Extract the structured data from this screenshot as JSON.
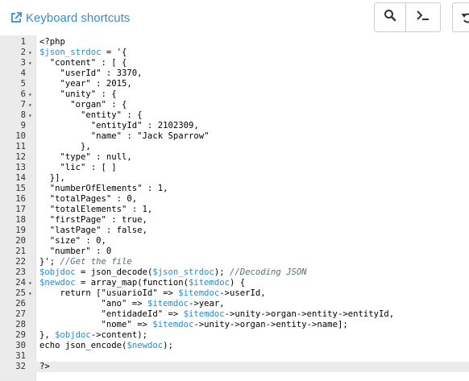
{
  "toolbar": {
    "shortcuts_label": "Keyboard shortcuts",
    "icons": {
      "shortcuts": "external-link-icon",
      "search": "search-icon",
      "console": "terminal-icon",
      "undo": "undo-icon"
    },
    "accent_color": "#3b8bd0"
  },
  "editor": {
    "language": "php",
    "active_line": 32,
    "colors": {
      "variable": "#268bd2",
      "comment": "#586e75",
      "text": "#000000",
      "gutter": "#ebebeb"
    },
    "lines": [
      {
        "n": "1",
        "fold": false,
        "tokens": [
          {
            "t": "<?php"
          }
        ]
      },
      {
        "n": "2",
        "fold": true,
        "tokens": [
          {
            "t": "$json_strdoc",
            "c": "v"
          },
          {
            "t": " = '{"
          }
        ]
      },
      {
        "n": "3",
        "fold": true,
        "tokens": [
          {
            "t": "  \"content\" : [ {"
          }
        ]
      },
      {
        "n": "4",
        "fold": false,
        "tokens": [
          {
            "t": "    \"userId\" : 3370,"
          }
        ]
      },
      {
        "n": "5",
        "fold": false,
        "tokens": [
          {
            "t": "    \"year\" : 2015,"
          }
        ]
      },
      {
        "n": "6",
        "fold": true,
        "tokens": [
          {
            "t": "    \"unity\" : {"
          }
        ]
      },
      {
        "n": "7",
        "fold": true,
        "tokens": [
          {
            "t": "      \"organ\" : {"
          }
        ]
      },
      {
        "n": "8",
        "fold": true,
        "tokens": [
          {
            "t": "        \"entity\" : {"
          }
        ]
      },
      {
        "n": "9",
        "fold": false,
        "tokens": [
          {
            "t": "          \"entityId\" : 2102309,"
          }
        ]
      },
      {
        "n": "10",
        "fold": false,
        "tokens": [
          {
            "t": "          \"name\" : \"Jack Sparrow\""
          }
        ]
      },
      {
        "n": "11",
        "fold": false,
        "tokens": [
          {
            "t": "        },"
          }
        ]
      },
      {
        "n": "12",
        "fold": false,
        "tokens": [
          {
            "t": "    \"type\" : null,"
          }
        ]
      },
      {
        "n": "13",
        "fold": false,
        "tokens": [
          {
            "t": "    \"lic\" : [ ]"
          }
        ]
      },
      {
        "n": "14",
        "fold": false,
        "tokens": [
          {
            "t": "  }],"
          }
        ]
      },
      {
        "n": "15",
        "fold": false,
        "tokens": [
          {
            "t": "  \"numberOfElements\" : 1,"
          }
        ]
      },
      {
        "n": "16",
        "fold": false,
        "tokens": [
          {
            "t": "  \"totalPages\" : 0,"
          }
        ]
      },
      {
        "n": "17",
        "fold": false,
        "tokens": [
          {
            "t": "  \"totalElements\" : 1,"
          }
        ]
      },
      {
        "n": "18",
        "fold": false,
        "tokens": [
          {
            "t": "  \"firstPage\" : true,"
          }
        ]
      },
      {
        "n": "19",
        "fold": false,
        "tokens": [
          {
            "t": "  \"lastPage\" : false,"
          }
        ]
      },
      {
        "n": "20",
        "fold": false,
        "tokens": [
          {
            "t": "  \"size\" : 0,"
          }
        ]
      },
      {
        "n": "21",
        "fold": false,
        "tokens": [
          {
            "t": "  \"number\" : 0"
          }
        ]
      },
      {
        "n": "22",
        "fold": false,
        "tokens": [
          {
            "t": "}'; "
          },
          {
            "t": "//Get the file",
            "c": "c"
          }
        ]
      },
      {
        "n": "23",
        "fold": false,
        "tokens": [
          {
            "t": "$objdoc",
            "c": "v"
          },
          {
            "t": " = json_decode("
          },
          {
            "t": "$json_strdoc",
            "c": "v"
          },
          {
            "t": "); "
          },
          {
            "t": "//Decoding JSON",
            "c": "c"
          }
        ]
      },
      {
        "n": "24",
        "fold": true,
        "tokens": [
          {
            "t": "$newdoc",
            "c": "v"
          },
          {
            "t": " = array_map(function("
          },
          {
            "t": "$itemdoc",
            "c": "v"
          },
          {
            "t": ") {"
          }
        ]
      },
      {
        "n": "25",
        "fold": true,
        "tokens": [
          {
            "t": "    return [\"usuarioId\" => "
          },
          {
            "t": "$itemdoc",
            "c": "v"
          },
          {
            "t": "->userId,"
          }
        ]
      },
      {
        "n": "26",
        "fold": false,
        "tokens": [
          {
            "t": "            \"ano\" => "
          },
          {
            "t": "$itemdoc",
            "c": "v"
          },
          {
            "t": "->year,"
          }
        ]
      },
      {
        "n": "27",
        "fold": false,
        "tokens": [
          {
            "t": "            \"entidadeId\" => "
          },
          {
            "t": "$itemdoc",
            "c": "v"
          },
          {
            "t": "->unity->organ->entity->entityId,"
          }
        ]
      },
      {
        "n": "28",
        "fold": false,
        "tokens": [
          {
            "t": "            \"nome\" => "
          },
          {
            "t": "$itemdoc",
            "c": "v"
          },
          {
            "t": "->unity->organ->entity->name];"
          }
        ]
      },
      {
        "n": "29",
        "fold": false,
        "tokens": [
          {
            "t": "}, "
          },
          {
            "t": "$objdoc",
            "c": "v"
          },
          {
            "t": "->content);"
          }
        ]
      },
      {
        "n": "30",
        "fold": false,
        "tokens": [
          {
            "t": "echo json_encode("
          },
          {
            "t": "$newdoc",
            "c": "v"
          },
          {
            "t": ");"
          }
        ]
      },
      {
        "n": "31",
        "fold": false,
        "tokens": [
          {
            "t": ""
          }
        ]
      },
      {
        "n": "32",
        "fold": false,
        "tokens": [
          {
            "t": "?>"
          }
        ]
      }
    ]
  }
}
